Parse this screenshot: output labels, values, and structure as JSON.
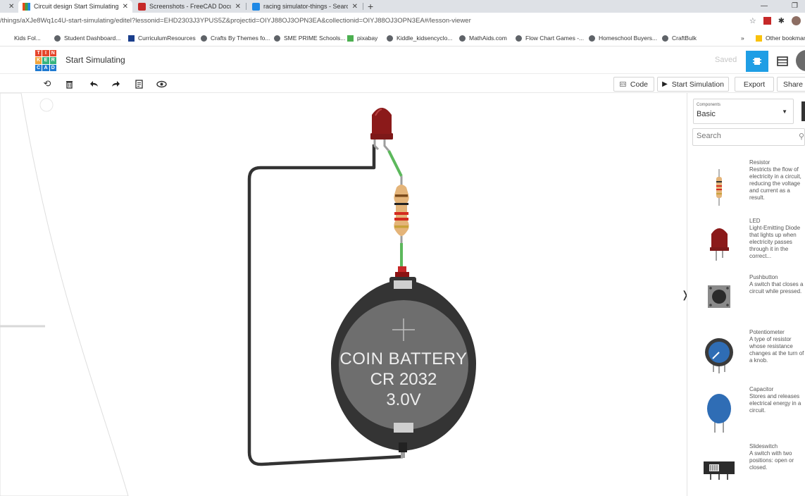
{
  "browser": {
    "tabs": [
      {
        "title": "Circuit design Start Simulating | T",
        "active": true
      },
      {
        "title": "Screenshots - FreeCAD Documen",
        "active": false
      },
      {
        "title": "racing simulator-things - Search",
        "active": false
      }
    ],
    "new_tab": "+",
    "url": "/things/aXJe8Wq1c4U-start-simulating/editel?lessonid=EHD2303J3YPUS5Z&projectid=OIYJ88OJ3OPN3EA&collectionid=OIYJ88OJ3OPN3EA#/lesson-viewer",
    "bookmarks": [
      "Kids Fol...",
      "Student Dashboard...",
      "CurriculumResources",
      "Crafts By Themes fo...",
      "SME PRIME Schools...",
      "pixabay",
      "Kiddle_kidsencyclo...",
      "MathAids.com",
      "Flow Chart Games -...",
      "Homeschool Buyers...",
      "CraftBulk"
    ],
    "other_bookmarks": "Other bookmarks",
    "overflow": "»"
  },
  "app": {
    "logo_letters": [
      "T",
      "I",
      "N",
      "K",
      "E",
      "R",
      "C",
      "A",
      "D"
    ],
    "title": "Start Simulating",
    "saved": "Saved"
  },
  "toolbar": {
    "code_label": "Code",
    "simulate_label": "Start Simulation",
    "export_label": "Export",
    "share_label": "Share"
  },
  "battery": {
    "line1": "COIN BATTERY",
    "line2": "CR 2032",
    "line3": "3.0V"
  },
  "panel": {
    "components_label": "Components",
    "components_value": "Basic",
    "search_placeholder": "Search",
    "toggle": "❭",
    "components": [
      {
        "name": "Resistor",
        "desc": "Restricts the flow of electricity in a circuit, reducing the voltage and current as a result."
      },
      {
        "name": "LED",
        "desc": "Light-Emitting Diode that lights up when electricity passes through it in the correct..."
      },
      {
        "name": "Pushbutton",
        "desc": "A switch that closes a circuit while pressed."
      },
      {
        "name": "Potentiometer",
        "desc": "A type of resistor whose resistance changes at the turn of a knob."
      },
      {
        "name": "Capacitor",
        "desc": "Stores and releases electrical energy in a circuit."
      },
      {
        "name": "Slideswitch",
        "desc": "A switch with two positions: open or closed."
      }
    ]
  },
  "colors": {
    "accent": "#1f9ee5",
    "led_red": "#8b1a1a",
    "wire_dark": "#333333",
    "wire_green": "#5cb85c"
  }
}
